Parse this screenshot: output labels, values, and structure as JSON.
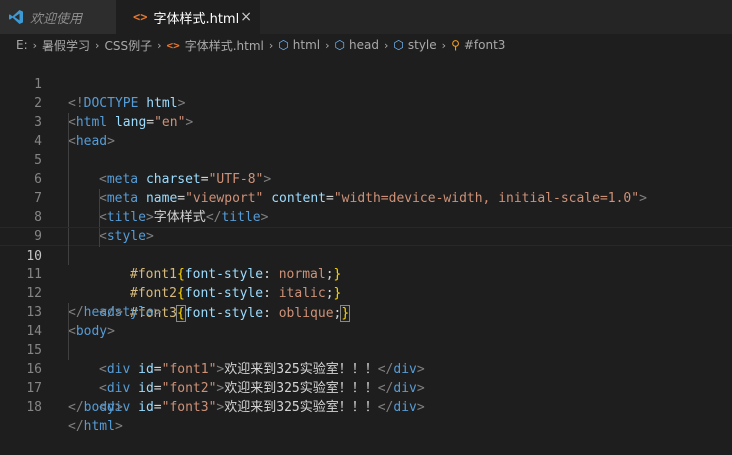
{
  "tabs": [
    {
      "label": "欢迎使用"
    },
    {
      "label": "字体样式.html",
      "icon_text": "<>",
      "close": "×"
    }
  ],
  "breadcrumb": {
    "drive": "E:",
    "folder1": "暑假学习",
    "folder2": "CSS例子",
    "file": "字体样式.html",
    "node1": "html",
    "node2": "head",
    "node3": "style",
    "node4": "#font3"
  },
  "lines": [
    {
      "n": "1",
      "s": [
        "<!",
        "DOCTYPE",
        " ",
        "html",
        ">"
      ]
    },
    {
      "n": "2",
      "s": [
        "<",
        "html",
        " ",
        "lang",
        "=",
        "\"en\"",
        ">"
      ]
    },
    {
      "n": "3",
      "s": [
        "<",
        "head",
        ">"
      ]
    },
    {
      "n": "4",
      "s": [
        "<",
        "meta",
        " ",
        "charset",
        "=",
        "\"UTF-8\"",
        ">"
      ]
    },
    {
      "n": "5",
      "s": [
        "<",
        "meta",
        " ",
        "name",
        "=",
        "\"viewport\"",
        " ",
        "content",
        "=",
        "\"width=device-width, initial-scale=1.0\"",
        ">"
      ]
    },
    {
      "n": "6",
      "s": [
        "<",
        "title",
        ">",
        "字体样式",
        "</",
        "title",
        ">"
      ]
    },
    {
      "n": "7",
      "s": [
        "<",
        "style",
        ">"
      ]
    },
    {
      "n": "8",
      "s": [
        "#font1",
        "{",
        "font-style",
        ": ",
        "normal",
        ";",
        "}"
      ]
    },
    {
      "n": "9",
      "s": [
        "#font2",
        "{",
        "font-style",
        ": ",
        "italic",
        ";",
        "}"
      ]
    },
    {
      "n": "10",
      "s": [
        "#font3",
        "{",
        "font-style",
        ": ",
        "oblique",
        ";",
        "}"
      ]
    },
    {
      "n": "11",
      "s": [
        "</",
        "style",
        ">"
      ]
    },
    {
      "n": "12",
      "s": [
        "</",
        "head",
        ">"
      ]
    },
    {
      "n": "13",
      "s": [
        "<",
        "body",
        ">"
      ]
    },
    {
      "n": "14",
      "s": [
        "<",
        "div",
        " ",
        "id",
        "=",
        "\"font1\"",
        ">",
        "欢迎来到325实验室！！！",
        "</",
        "div",
        ">"
      ]
    },
    {
      "n": "15",
      "s": [
        "<",
        "div",
        " ",
        "id",
        "=",
        "\"font2\"",
        ">",
        "欢迎来到325实验室！！！",
        "</",
        "div",
        ">"
      ]
    },
    {
      "n": "16",
      "s": [
        "<",
        "div",
        " ",
        "id",
        "=",
        "\"font3\"",
        ">",
        "欢迎来到325实验室！！！",
        "</",
        "div",
        ">"
      ]
    },
    {
      "n": "17",
      "s": [
        "</",
        "body",
        ">"
      ]
    },
    {
      "n": "18",
      "s": [
        "</",
        "html",
        ">"
      ]
    }
  ],
  "colors": {
    "background": "#1e1e1e",
    "tag": "#569cd6",
    "attribute": "#9cdcfe",
    "string": "#ce9178",
    "selector": "#d7ba7d",
    "line_number": "#858585"
  }
}
